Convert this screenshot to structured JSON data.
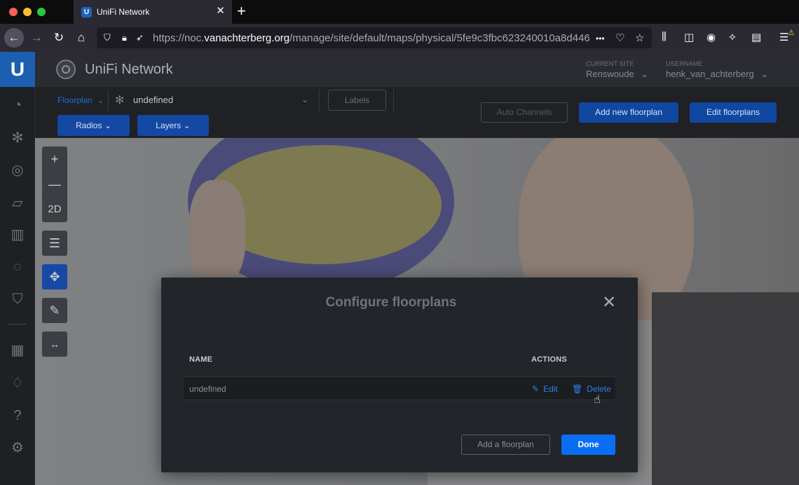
{
  "browser": {
    "tab_title": "UniFi Network",
    "url_prefix": "https://noc.",
    "url_domain": "vanachterberg.org",
    "url_path": "/manage/site/default/maps/physical/5fe9c3fbc623240010a8d446",
    "url_more": "•••"
  },
  "header": {
    "brand": "UniFi Network",
    "current_site_label": "CURRENT SITE",
    "current_site_value": "Renswoude",
    "username_label": "USERNAME",
    "username_value": "henk_van_achterberg"
  },
  "subbar": {
    "floorplan_label": "Floorplan",
    "floorplan_selected": "undefined",
    "labels_button": "Labels",
    "radios_button": "Radios",
    "layers_button": "Layers",
    "auto_channels_button": "Auto Channels",
    "add_floorplan_button": "Add new floorplan",
    "edit_floorplans_button": "Edit floorplans"
  },
  "tools": {
    "mode_label": "2D"
  },
  "modal": {
    "title": "Configure floorplans",
    "col_name": "NAME",
    "col_actions": "ACTIONS",
    "rows": [
      {
        "name": "undefined",
        "edit": "Edit",
        "delete": "Delete"
      }
    ],
    "add_button": "Add a floorplan",
    "done_button": "Done"
  },
  "colors": {
    "accent": "#0a6ef4",
    "link": "#2d7fe6",
    "sidebar_logo": "#1c5fb0"
  }
}
